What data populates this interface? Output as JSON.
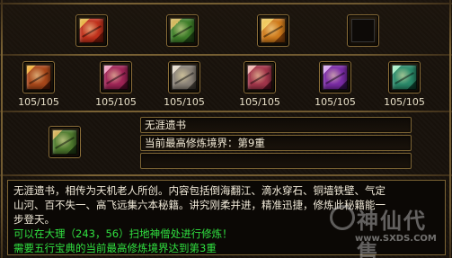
{
  "top_slots": [
    {
      "icon": "red-gold-book-icon",
      "color": "#c0311c",
      "accent": "#e7b648"
    },
    {
      "icon": "green-gold-book-icon",
      "color": "#3f7e2a",
      "accent": "#d3b65a"
    },
    {
      "icon": "orange-gold-book-icon",
      "color": "#cf7b1c",
      "accent": "#f0c85a"
    },
    {
      "icon": "empty-slot-icon",
      "color": "#111111",
      "accent": "#333333"
    }
  ],
  "skill_books": [
    {
      "icon": "fire-book-icon",
      "color": "#a8471a",
      "count": "105/105"
    },
    {
      "icon": "magenta-book-icon",
      "color": "#a02457",
      "count": "105/105"
    },
    {
      "icon": "silver-book-icon",
      "color": "#8a8278",
      "count": "105/105"
    },
    {
      "icon": "rose-book-icon",
      "color": "#a2354a",
      "count": "105/105"
    },
    {
      "icon": "purple-book-icon",
      "color": "#7b2ba6",
      "count": "105/105"
    },
    {
      "icon": "teal-book-icon",
      "color": "#2a8a6a",
      "count": "105/105"
    }
  ],
  "main_book": {
    "icon": "wuya-book-icon",
    "color": "#4e7a2e"
  },
  "info": {
    "name": "无涯遗书",
    "realm": "当前最高修炼境界：第9重",
    "empty": ""
  },
  "description": {
    "line1": "无涯遗书，相传为天机老人所创。内容包括倒海翻江、滴水穿石、铜墙铁壁、气定",
    "line2": "山河、百不失一、高飞远集六本秘籍。讲究刚柔并进，精准迅捷，修炼此秘籍能一",
    "line3": "步登天。",
    "line4": "可以在大理（243，56）扫地神僧处进行修炼！",
    "line5": "需要五行宝典的当前最高修炼境界达到第3重"
  },
  "watermark": {
    "title": "神仙代售",
    "url": "www.SXDS.COM"
  }
}
